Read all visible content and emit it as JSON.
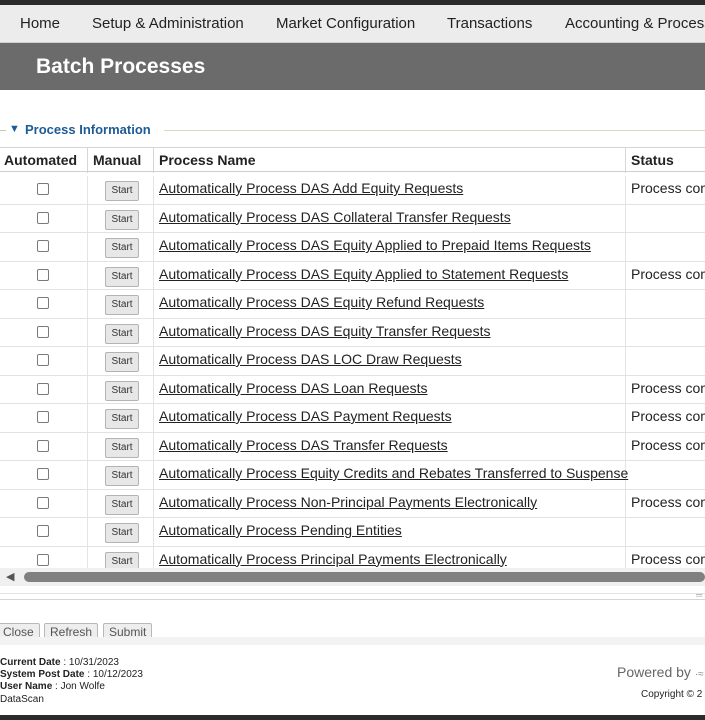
{
  "nav": {
    "items": [
      {
        "label": "Home"
      },
      {
        "label": "Setup & Administration"
      },
      {
        "label": "Market Configuration"
      },
      {
        "label": "Transactions"
      },
      {
        "label": "Accounting & Processi"
      }
    ]
  },
  "page": {
    "title": "Batch Processes"
  },
  "section": {
    "title": "Process Information",
    "expanded_icon": "triangle-down-icon"
  },
  "table": {
    "columns": {
      "automated": "Automated",
      "manual": "Manual",
      "process_name": "Process Name",
      "status": "Status"
    },
    "start_label": "Start",
    "rows": [
      {
        "name": "Automatically Process DAS Add Equity Requests",
        "status": "Process com",
        "automated": false
      },
      {
        "name": "Automatically Process DAS Collateral Transfer Requests",
        "status": "",
        "automated": false
      },
      {
        "name": "Automatically Process DAS Equity Applied to Prepaid Items Requests",
        "status": "",
        "automated": false
      },
      {
        "name": "Automatically Process DAS Equity Applied to Statement Requests",
        "status": "Process com",
        "automated": false
      },
      {
        "name": "Automatically Process DAS Equity Refund Requests",
        "status": "",
        "automated": false
      },
      {
        "name": "Automatically Process DAS Equity Transfer Requests",
        "status": "",
        "automated": false
      },
      {
        "name": "Automatically Process DAS LOC Draw Requests",
        "status": "",
        "automated": false
      },
      {
        "name": "Automatically Process DAS Loan Requests",
        "status": "Process com",
        "automated": false
      },
      {
        "name": "Automatically Process DAS Payment Requests",
        "status": "Process com",
        "automated": false
      },
      {
        "name": "Automatically Process DAS Transfer Requests",
        "status": "Process com",
        "automated": false
      },
      {
        "name": "Automatically Process Equity Credits and Rebates Transferred to Suspense",
        "status": "",
        "automated": false
      },
      {
        "name": "Automatically Process Non-Principal Payments Electronically",
        "status": "Process com",
        "automated": false
      },
      {
        "name": "Automatically Process Pending Entities",
        "status": "",
        "automated": false
      },
      {
        "name": "Automatically Process Principal Payments Electronically",
        "status": "Process com",
        "automated": false
      }
    ]
  },
  "actions": {
    "close": "Close",
    "refresh": "Refresh",
    "submit": "Submit"
  },
  "footer": {
    "current_date_label": "Current Date",
    "current_date": "10/31/2023",
    "system_post_date_label": "System Post Date",
    "system_post_date": "10/12/2023",
    "user_name_label": "User Name",
    "user_name": "Jon Wolfe",
    "company": "DataScan",
    "powered_by": "Powered by",
    "copyright": "Copyright © 2"
  },
  "colors": {
    "accent": "#1e5b96",
    "titlebar": "#6b6b6b",
    "navbar": "#ececec"
  }
}
